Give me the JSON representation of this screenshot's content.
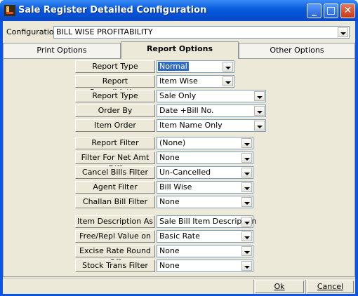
{
  "window": {
    "title": "Sale Register Detailed Configuration"
  },
  "configuration": {
    "label": "Configuration",
    "value": "BILL WISE PROFITABILITY"
  },
  "tabs": [
    {
      "label": "Print Options"
    },
    {
      "label": "Report Options"
    },
    {
      "label": "Other Options"
    }
  ],
  "rows": [
    {
      "label": "Report Type",
      "value": "Normal"
    },
    {
      "label": "Report Consolidation",
      "value": "Item Wise"
    },
    {
      "label": "Report Type",
      "value": "Sale Only"
    },
    {
      "label": "Order By",
      "value": "Date +Bill No."
    },
    {
      "label": "Item Order",
      "value": "Item Name Only"
    },
    {
      "label": "Report Filter",
      "value": "(None)"
    },
    {
      "label": "Filter For Net Amt Diff",
      "value": "None"
    },
    {
      "label": "Cancel Bills Filter",
      "value": "Un-Cancelled"
    },
    {
      "label": "Agent Filter",
      "value": "Bill Wise"
    },
    {
      "label": "Challan Bill Filter",
      "value": "None"
    },
    {
      "label": "Item Description As",
      "value": "Sale Bill Item Description"
    },
    {
      "label": "Free/Repl Value on",
      "value": "Basic Rate"
    },
    {
      "label": "Excise Rate Round Off",
      "value": "None"
    },
    {
      "label": "Stock Trans Filter",
      "value": "None"
    }
  ],
  "buttons": {
    "ok": "Ok",
    "cancel": "Cancel"
  }
}
